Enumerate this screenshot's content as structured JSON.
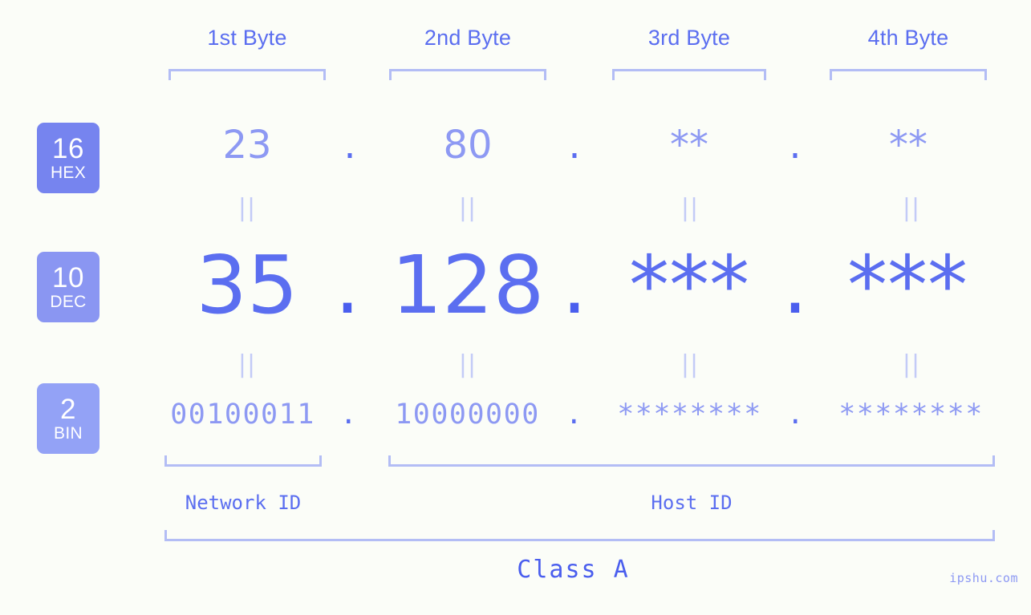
{
  "background_color": "#fbfdf8",
  "accent_color": "#5b6ef0",
  "accent_light": "#8d99f3",
  "bracket_color": "#b3bdf5",
  "header": {
    "byte_labels": [
      "1st Byte",
      "2nd Byte",
      "3rd Byte",
      "4th Byte"
    ]
  },
  "bases": [
    {
      "num": "16",
      "sub": "HEX",
      "color": "#7684ef"
    },
    {
      "num": "10",
      "sub": "DEC",
      "color": "#8a96f2"
    },
    {
      "num": "2",
      "sub": "BIN",
      "color": "#93a2f6"
    }
  ],
  "rows": {
    "hex": {
      "values": [
        "23",
        "80",
        "**",
        "**"
      ],
      "separator": "."
    },
    "dec": {
      "values": [
        "35",
        "128",
        "***",
        "***"
      ],
      "separator": "."
    },
    "bin": {
      "values": [
        "00100011",
        "10000000",
        "********",
        "********"
      ],
      "separator": "."
    }
  },
  "connector": "||",
  "segments": {
    "network_id": "Network ID",
    "host_id": "Host ID"
  },
  "class_label": "Class A",
  "watermark": "ipshu.com"
}
